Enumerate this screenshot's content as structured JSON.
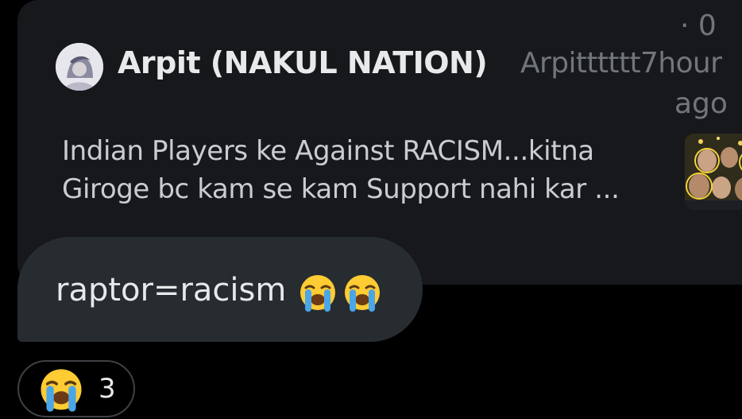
{
  "quoted_post": {
    "display_name": "Arpit (NAKUL NATION)",
    "handle_and_time": "Arpitttttt7hour",
    "time_suffix": "ago",
    "count_label": "· 0",
    "text_line1": "Indian Players ke Against RACISM...kitna",
    "text_line2": "Giroge bc kam se kam Support nahi kar ..."
  },
  "message": {
    "text": "raptor=racism",
    "emojis": [
      "loudly-crying-face-icon",
      "loudly-crying-face-icon"
    ]
  },
  "reaction": {
    "emoji": "loudly-crying-face-icon",
    "count": "3"
  },
  "colors": {
    "background": "#000000",
    "card": "#16181c",
    "bubble": "#272c31",
    "primary_text": "#e7e9ea",
    "muted_text": "#71767b",
    "emoji_yellow": "#ffcc33",
    "emoji_tears": "#4aa6e8"
  }
}
